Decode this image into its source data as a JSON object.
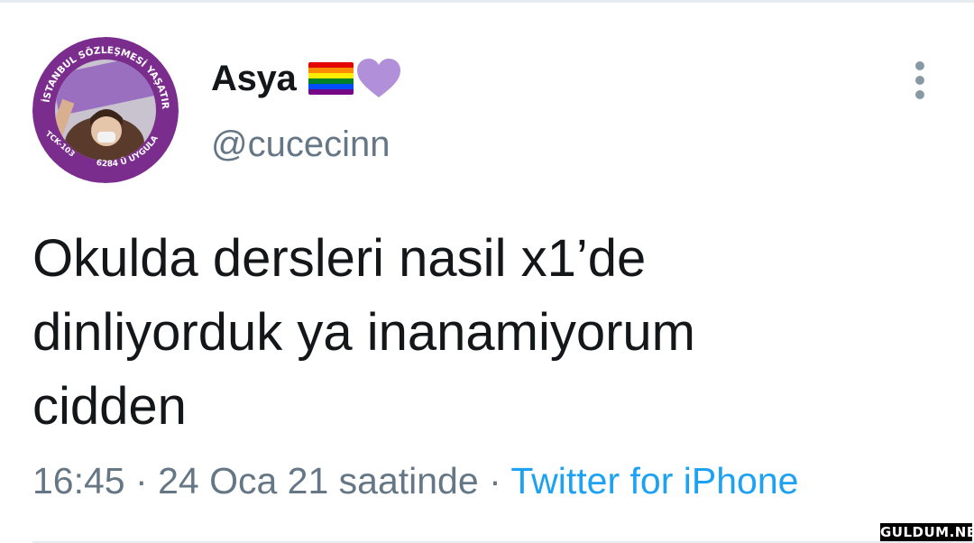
{
  "tweet": {
    "author": {
      "display_name": "Asya",
      "handle": "@cucecinn",
      "avatar_ring_text": "İSTANBUL SÖZLEŞMESİ YAŞATIR",
      "avatar_bottom_text": "6284 Ü UYGULA",
      "avatar_left_text": "TCK-103",
      "name_emojis": [
        "rainbow-flag",
        "purple-heart"
      ]
    },
    "text_lines": [
      "Okulda dersleri nasil x1’de",
      "dinliyorduk ya inanamiyorum",
      "cidden"
    ],
    "time": "16:45",
    "separator": "·",
    "date": "24 Oca 21 saatinde",
    "source": "Twitter for iPhone"
  },
  "watermark": "GULDUM.NET",
  "icons": {
    "more": "more-vertical-icon"
  },
  "colors": {
    "text_primary": "#14171a",
    "text_secondary": "#657786",
    "link": "#1da1f2",
    "avatar_purple": "#7b2d8e",
    "heart": "#b18fd9"
  }
}
